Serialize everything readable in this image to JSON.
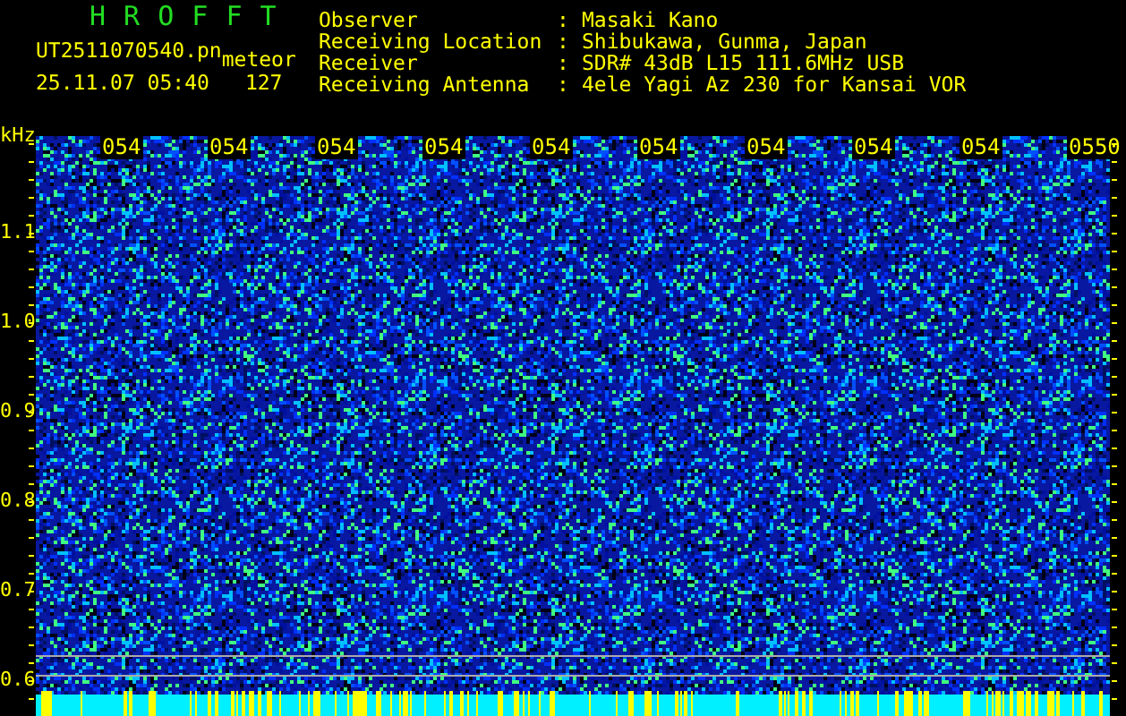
{
  "header": {
    "title": "H R O F F T",
    "filename": "UT2511070540.pn",
    "mode": "meteor",
    "timestamp": "25.11.07 05:40",
    "count": "127"
  },
  "info": [
    {
      "label": "Observer",
      "separator": ":",
      "value": "Masaki Kano"
    },
    {
      "label": "Receiving Location",
      "separator": ":",
      "value": "Shibukawa, Gunma, Japan"
    },
    {
      "label": "Receiver",
      "separator": ":",
      "value": "SDR# 43dB L15 111.6MHz USB"
    },
    {
      "label": "Receiving Antenna",
      "separator": ":",
      "value": "4ele Yagi Az 230 for Kansai VOR"
    }
  ],
  "plot": {
    "unit": "kHz",
    "y_labels": [
      "1.1",
      "1.0",
      "0.9",
      "0.8",
      "0.7",
      "0.6"
    ],
    "time_labels": [
      "054",
      "054",
      "054",
      "054",
      "054",
      "054",
      "054",
      "054",
      "054",
      "0550"
    ]
  }
}
